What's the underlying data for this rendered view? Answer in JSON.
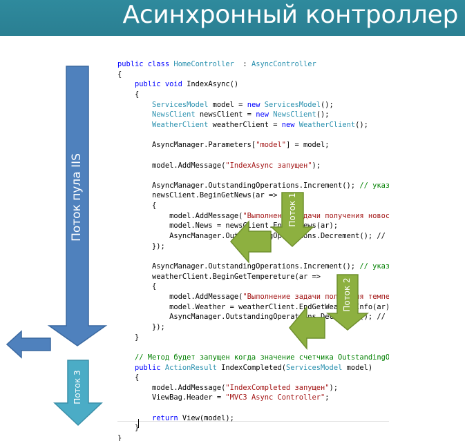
{
  "slide": {
    "title": "Асинхронный контроллер"
  },
  "labels": {
    "iis_thread": "Поток пула IIS",
    "thread1": "Поток 1",
    "thread2": "Поток 2",
    "thread3": "Поток 3"
  },
  "code_lines": [
    [
      [
        "kw",
        "public class "
      ],
      [
        "ty",
        "HomeController"
      ],
      [
        "",
        "  : "
      ],
      [
        "ty",
        "AsyncController"
      ]
    ],
    [
      [
        "",
        "{"
      ]
    ],
    [
      [
        "",
        "    "
      ],
      [
        "kw",
        "public void "
      ],
      [
        "",
        "IndexAsync()"
      ]
    ],
    [
      [
        "",
        "    {"
      ]
    ],
    [
      [
        "",
        "        "
      ],
      [
        "ty",
        "ServicesModel"
      ],
      [
        "",
        " model = "
      ],
      [
        "kw",
        "new "
      ],
      [
        "ty",
        "ServicesModel"
      ],
      [
        "",
        "();"
      ]
    ],
    [
      [
        "",
        "        "
      ],
      [
        "ty",
        "NewsClient"
      ],
      [
        "",
        " newsClient = "
      ],
      [
        "kw",
        "new "
      ],
      [
        "ty",
        "NewsClient"
      ],
      [
        "",
        "();"
      ]
    ],
    [
      [
        "",
        "        "
      ],
      [
        "ty",
        "WeatherClient"
      ],
      [
        "",
        " weatherClient = "
      ],
      [
        "kw",
        "new "
      ],
      [
        "ty",
        "WeatherClient"
      ],
      [
        "",
        "();"
      ]
    ],
    [],
    [
      [
        "",
        "        AsyncManager.Parameters["
      ],
      [
        "str",
        "\"model\""
      ],
      [
        "",
        "] = model;"
      ]
    ],
    [],
    [
      [
        "",
        "        model.AddMessage("
      ],
      [
        "str",
        "\"IndexAsync запущен\""
      ],
      [
        "",
        ");"
      ]
    ],
    [],
    [
      [
        "",
        "        AsyncManager.OutstandingOperations.Increment(); "
      ],
      [
        "cm",
        "// указ"
      ]
    ],
    [
      [
        "",
        "        newsClient.BeginGetNews(ar =>"
      ]
    ],
    [
      [
        "",
        "        {"
      ]
    ],
    [
      [
        "",
        "            model.AddMessage("
      ],
      [
        "str",
        "\"Выполнение задачи получения новос"
      ]
    ],
    [
      [
        "",
        "            model.News = newsClient.EndGetNews(ar);"
      ]
    ],
    [
      [
        "",
        "            AsyncManager.OutstandingOperations.Decrement(); //"
      ]
    ],
    [
      [
        "",
        "        });"
      ]
    ],
    [],
    [
      [
        "",
        "        AsyncManager.OutstandingOperations.Increment(); "
      ],
      [
        "cm",
        "// указ"
      ]
    ],
    [
      [
        "",
        "        weatherClient.BeginGetTempereture(ar =>"
      ]
    ],
    [
      [
        "",
        "        {"
      ]
    ],
    [
      [
        "",
        "            model.AddMessage("
      ],
      [
        "str",
        "\"Выполнение задачи получения темпе"
      ]
    ],
    [
      [
        "",
        "            model.Weather = weatherClient.EndGetWeatherInfo(ar)"
      ]
    ],
    [
      [
        "",
        "            AsyncManager.OutstandingOperations.Decrement(); //"
      ]
    ],
    [
      [
        "",
        "        });"
      ]
    ],
    [
      [
        "",
        "    }"
      ]
    ],
    [],
    [
      [
        "",
        "    "
      ],
      [
        "cm",
        "// Метод будет запущен когда значение счетчика OutstandingO"
      ]
    ],
    [
      [
        "",
        "    "
      ],
      [
        "kw",
        "public "
      ],
      [
        "ty",
        "ActionResult"
      ],
      [
        "",
        " IndexCompleted("
      ],
      [
        "ty",
        "ServicesModel"
      ],
      [
        "",
        " model)"
      ]
    ],
    [
      [
        "",
        "    {"
      ]
    ],
    [
      [
        "",
        "        model.AddMessage("
      ],
      [
        "str",
        "\"IndexCompleted запущен\""
      ],
      [
        "",
        ");"
      ]
    ],
    [
      [
        "",
        "        ViewBag.Header = "
      ],
      [
        "str",
        "\"MVC3 Async Controller\""
      ],
      [
        "",
        ";"
      ]
    ],
    [],
    [
      [
        "",
        "        "
      ],
      [
        "kw",
        "return "
      ],
      [
        "",
        "View(model);"
      ]
    ],
    [
      [
        "",
        "    }"
      ]
    ],
    [
      [
        "",
        "}"
      ]
    ]
  ],
  "colors": {
    "header_bg": "#2e879a",
    "iis_arrow": "#4f81bd",
    "thread_arrows": "#8db040",
    "thread3_arrow": "#4bacc6"
  }
}
